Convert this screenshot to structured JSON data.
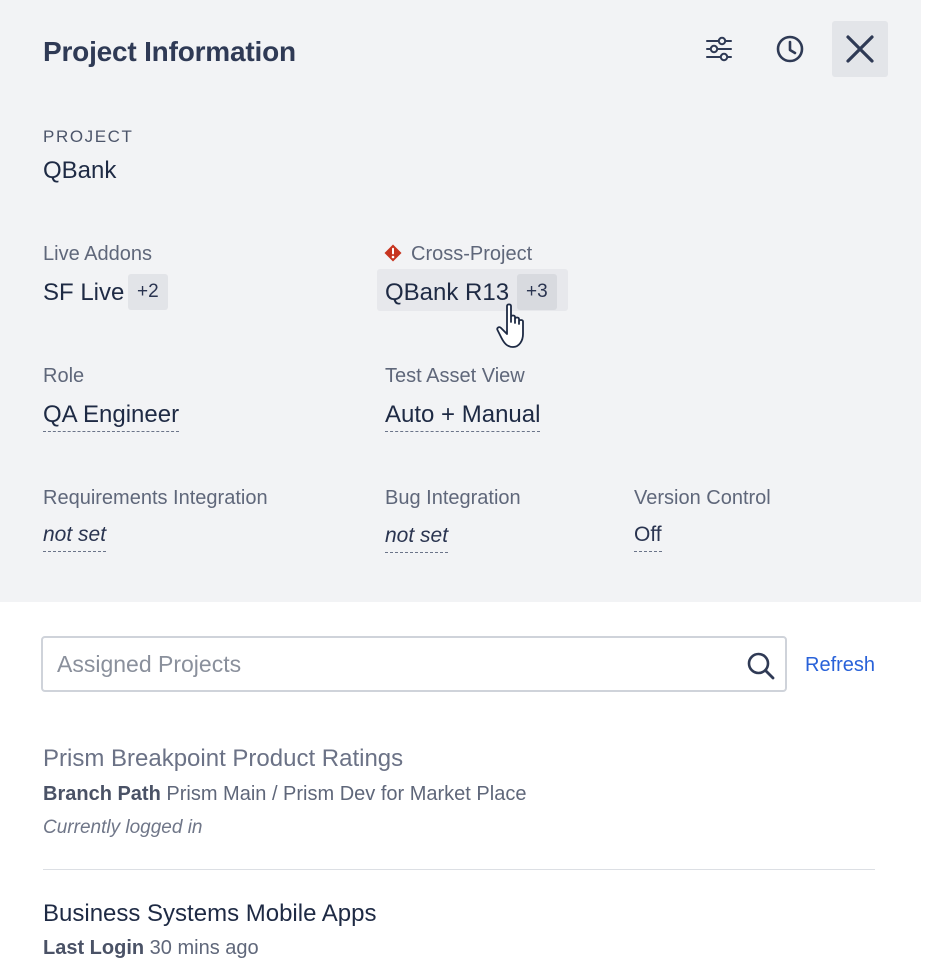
{
  "header": {
    "title": "Project Information",
    "icons": [
      "sliders-icon",
      "history-clock-icon",
      "close-icon"
    ]
  },
  "project": {
    "label": "PROJECT",
    "value": "QBank"
  },
  "live_addons": {
    "label": "Live Addons",
    "value": "SF Live",
    "more": "+2"
  },
  "cross_project": {
    "label": "Cross-Project",
    "value": "QBank R13",
    "more": "+3",
    "warning_color": "#c7341f"
  },
  "role": {
    "label": "Role",
    "value": "QA Engineer"
  },
  "test_asset_view": {
    "label": "Test Asset View",
    "value": "Auto + Manual"
  },
  "requirements_integration": {
    "label": "Requirements Integration",
    "value": "not set"
  },
  "bug_integration": {
    "label": "Bug Integration",
    "value": "not set"
  },
  "version_control": {
    "label": "Version Control",
    "value": "Off"
  },
  "search": {
    "placeholder": "Assigned Projects",
    "refresh_label": "Refresh"
  },
  "projects": [
    {
      "name": "Prism Breakpoint Product Ratings",
      "meta_label": "Branch Path",
      "meta_value": "Prism Main / Prism Dev for Market Place",
      "note": "Currently logged in"
    },
    {
      "name": "Business Systems Mobile Apps",
      "meta_label": "Last Login",
      "meta_value": "30 mins ago"
    }
  ],
  "colors": {
    "accent_link": "#2962d9",
    "header_bg": "#f2f3f5",
    "text_dark": "#1e2a44"
  }
}
